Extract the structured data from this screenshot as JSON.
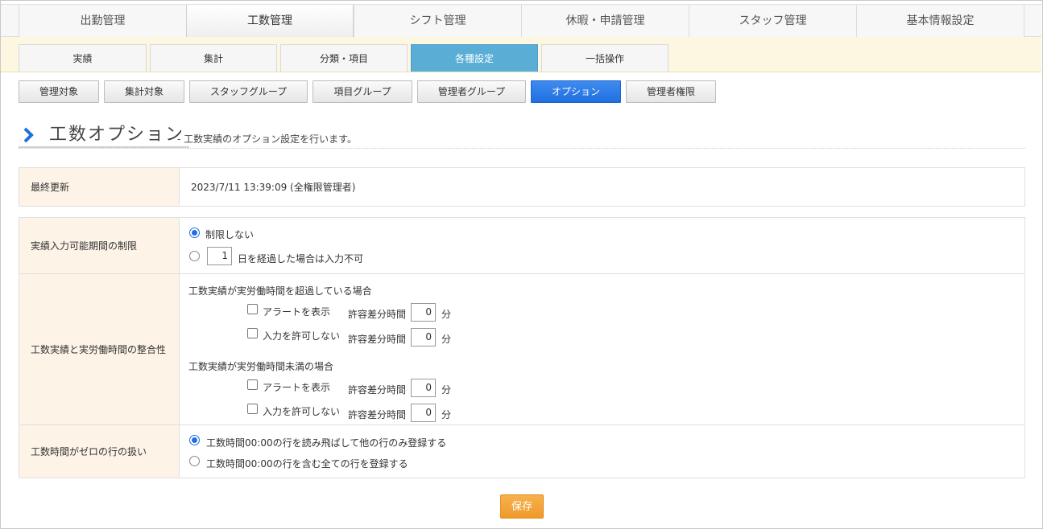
{
  "topnav": {
    "tabs": [
      "出勤管理",
      "工数管理",
      "シフト管理",
      "休暇・申請管理",
      "スタッフ管理",
      "基本情報設定"
    ]
  },
  "subnav": {
    "tabs": [
      "実績",
      "集計",
      "分類・項目",
      "各種設定",
      "一括操作"
    ]
  },
  "btnnav": {
    "buttons": [
      "管理対象",
      "集計対象",
      "スタッフグループ",
      "項目グループ",
      "管理者グループ",
      "オプション",
      "管理者権限"
    ]
  },
  "heading": {
    "title": "工数オプション",
    "desc": "- 工数実績のオプション設定を行います。"
  },
  "last_updated": {
    "label": "最終更新",
    "value": "2023/7/11 13:39:09 (全権限管理者)"
  },
  "input_period": {
    "label": "実績入力可能期間の制限",
    "opt_none": "制限しない",
    "days_value": "1",
    "opt_days_suffix": "日を経過した場合は入力不可"
  },
  "consistency": {
    "label": "工数実績と実労働時間の整合性",
    "over_title": "工数実績が実労働時間を超過している場合",
    "under_title": "工数実績が実労働時間未満の場合",
    "alert_label": "アラートを表示",
    "deny_label": "入力を許可しない",
    "tolerance_label": "許容差分時間",
    "unit": "分",
    "over_alert_value": "0",
    "over_deny_value": "0",
    "under_alert_value": "0",
    "under_deny_value": "0"
  },
  "zero_rows": {
    "label": "工数時間がゼロの行の扱い",
    "opt_skip": "工数時間00:00の行を読み飛ばして他の行のみ登録する",
    "opt_all": "工数時間00:00の行を含む全ての行を登録する"
  },
  "save_label": "保存",
  "colors": {
    "accent_blue": "#1e6fe0",
    "subtab_active": "#5aaed6",
    "save_orange": "#f0a030",
    "label_bg": "#fdf3e7",
    "subnav_bg": "#fdf7e2"
  }
}
